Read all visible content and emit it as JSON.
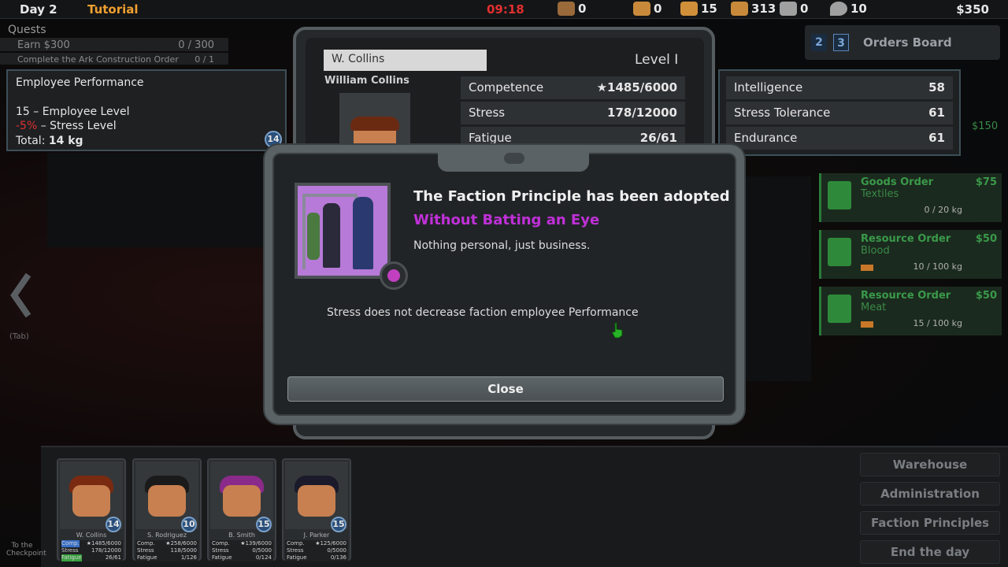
{
  "topbar": {
    "day": "Day 2",
    "mode": "Tutorial",
    "clock": "09:18",
    "resources": [
      {
        "icon": "worker-icon",
        "value": "0",
        "color": "#9a6a3a"
      },
      {
        "icon": "wrench-icon",
        "value": "0",
        "color": "#c88a3a"
      },
      {
        "icon": "meat-icon",
        "value": "15",
        "color": "#d0903a"
      },
      {
        "icon": "bone-icon",
        "value": "313",
        "color": "#c88a3a"
      },
      {
        "icon": "tools-icon",
        "value": "0",
        "color": "#a0a0a0"
      },
      {
        "icon": "blood-drop-icon",
        "value": "10",
        "color": "#a0a0a0"
      }
    ],
    "money": "$350"
  },
  "quests": {
    "title": "Quests",
    "items": [
      {
        "label": "Earn $300",
        "progress": "0 / 300"
      },
      {
        "label": "Complete the Ark Construction Order",
        "progress": "0 / 1"
      }
    ]
  },
  "performance": {
    "title": "Employee Performance",
    "line1": "15 – Employee Level",
    "line2_red": "-5%",
    "line2_rest": " – Stress Level",
    "total_label": "Total: ",
    "total_value": "14 kg",
    "badge": "14"
  },
  "employee": {
    "short_name": "W. Collins",
    "full_name": "William Collins",
    "level": "Level I",
    "stats": [
      {
        "label": "Competence",
        "value": "★1485/6000"
      },
      {
        "label": "Stress",
        "value": "178/12000"
      },
      {
        "label": "Fatigue",
        "value": "26/61"
      }
    ],
    "attributes": [
      {
        "label": "Intelligence",
        "value": "58"
      },
      {
        "label": "Stress Tolerance",
        "value": "61"
      },
      {
        "label": "Endurance",
        "value": "61"
      }
    ]
  },
  "orders": {
    "tabs": [
      "2",
      "3"
    ],
    "title": "Orders Board",
    "side_money": "$150",
    "items": [
      {
        "title": "Goods Order",
        "sub": "Textiles",
        "price": "$75",
        "qty": "0 / 20 kg",
        "bar": false
      },
      {
        "title": "Resource Order",
        "sub": "Blood",
        "price": "$50",
        "qty": "10 / 100 kg",
        "bar": true
      },
      {
        "title": "Resource Order",
        "sub": "Meat",
        "price": "$50",
        "qty": "15 / 100 kg",
        "bar": true
      }
    ]
  },
  "tab_hint": "(Tab)",
  "modal": {
    "title": "The Faction Principle has been adopted",
    "subtitle": "Without Batting an Eye",
    "quote": "Nothing personal, just business.",
    "effect": "Stress does not decrease faction employee Performance",
    "close_label": "Close",
    "subtitle_color": "#c030d8"
  },
  "employees": [
    {
      "name": "W. Collins",
      "level": "14",
      "comp": "★1485/6000",
      "stress": "178/12000",
      "fatigue": "26/61",
      "hair": "#7a2a10"
    },
    {
      "name": "S. Rodriguez",
      "level": "10",
      "comp": "★258/6000",
      "stress": "118/5000",
      "fatigue": "1/126",
      "hair": "#1a1a1a"
    },
    {
      "name": "B. Smith",
      "level": "15",
      "comp": "★139/6000",
      "stress": "0/5000",
      "fatigue": "0/124",
      "hair": "#8a2a8a"
    },
    {
      "name": "J. Parker",
      "level": "15",
      "comp": "★125/6000",
      "stress": "0/5000",
      "fatigue": "0/136",
      "hair": "#1a1a2a"
    }
  ],
  "employee_row_labels": {
    "comp": "Comp.",
    "stress": "Stress",
    "fatigue": "Fatigue"
  },
  "checkpoint": "To the Checkpoint",
  "right_buttons": [
    "Warehouse",
    "Administration",
    "Faction Principles",
    "End the day"
  ]
}
